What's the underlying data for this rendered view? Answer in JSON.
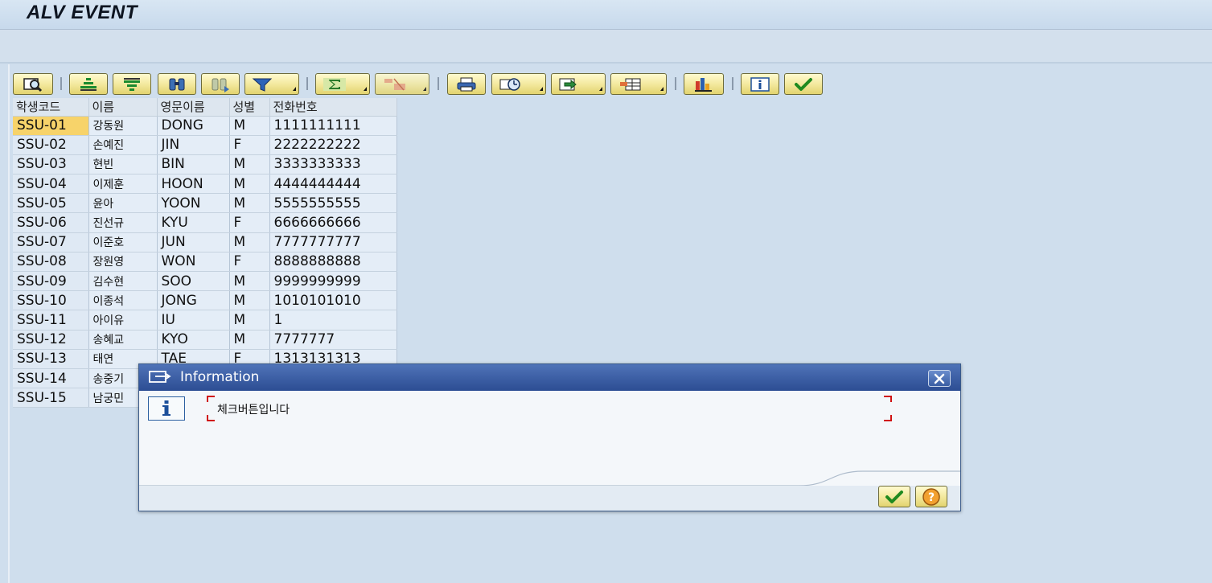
{
  "window": {
    "title": "ALV EVENT"
  },
  "toolbar": {
    "buttons": [
      {
        "icon": "details-icon"
      },
      {
        "icon": "sort-ascending-icon"
      },
      {
        "icon": "sort-descending-icon"
      },
      {
        "icon": "find-icon"
      },
      {
        "icon": "find-next-icon"
      },
      {
        "icon": "filter-icon"
      },
      {
        "icon": "sum-icon"
      },
      {
        "icon": "subtotal-icon"
      },
      {
        "icon": "print-icon"
      },
      {
        "icon": "views-icon"
      },
      {
        "icon": "export-icon"
      },
      {
        "icon": "layout-icon"
      },
      {
        "icon": "graphic-icon"
      },
      {
        "icon": "info-icon"
      },
      {
        "icon": "check-icon"
      }
    ]
  },
  "grid": {
    "columns": [
      "학생코드",
      "이름",
      "영문이름",
      "성별",
      "전화번호"
    ],
    "rows": [
      [
        "SSU-01",
        "강동원",
        "DONG",
        "M",
        "1111111111"
      ],
      [
        "SSU-02",
        "손예진",
        "JIN",
        "F",
        "2222222222"
      ],
      [
        "SSU-03",
        "현빈",
        "BIN",
        "M",
        "3333333333"
      ],
      [
        "SSU-04",
        "이제훈",
        "HOON",
        "M",
        "4444444444"
      ],
      [
        "SSU-05",
        "윤아",
        "YOON",
        "M",
        "5555555555"
      ],
      [
        "SSU-06",
        "진선규",
        "KYU",
        "F",
        "6666666666"
      ],
      [
        "SSU-07",
        "이준호",
        "JUN",
        "M",
        "7777777777"
      ],
      [
        "SSU-08",
        "장원영",
        "WON",
        "F",
        "8888888888"
      ],
      [
        "SSU-09",
        "김수현",
        "SOO",
        "M",
        "9999999999"
      ],
      [
        "SSU-10",
        "이종석",
        "JONG",
        "M",
        "1010101010"
      ],
      [
        "SSU-11",
        "아이유",
        "IU",
        "M",
        "1"
      ],
      [
        "SSU-12",
        "송혜교",
        "KYO",
        "M",
        "7777777"
      ],
      [
        "SSU-13",
        "태연",
        "TAE",
        "F",
        "1313131313"
      ],
      [
        "SSU-14",
        "송중기",
        "",
        "",
        ""
      ],
      [
        "SSU-15",
        "남궁민",
        "",
        "",
        ""
      ]
    ],
    "selected_cell": "SSU-01"
  },
  "dialog": {
    "title": "Information",
    "message": "체크버튼입니다"
  },
  "colors": {
    "background": "#cfdeed",
    "dialog_title": "#2c4d93",
    "selected_cell": "#f7d36a",
    "button_face": "#f2e79a",
    "field_corner": "#d01212"
  }
}
